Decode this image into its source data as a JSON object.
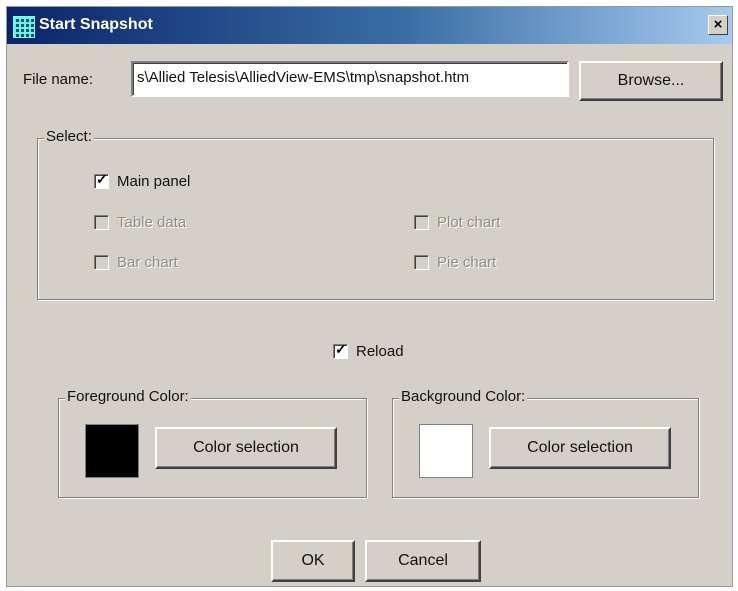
{
  "window": {
    "title": "Start Snapshot",
    "close_glyph": "×",
    "icon": "grid-app-icon"
  },
  "file": {
    "label": "File name:",
    "value": "s\\Allied Telesis\\AlliedView-EMS\\tmp\\snapshot.htm",
    "browse_label": "Browse..."
  },
  "select": {
    "legend": "Select:",
    "items": [
      {
        "label": "Main panel",
        "checked": true,
        "enabled": true
      },
      {
        "label": "Table data",
        "checked": false,
        "enabled": false
      },
      {
        "label": "Plot chart",
        "checked": false,
        "enabled": false
      },
      {
        "label": "Bar chart",
        "checked": false,
        "enabled": false
      },
      {
        "label": "Pie chart",
        "checked": false,
        "enabled": false
      }
    ]
  },
  "reload": {
    "label": "Reload",
    "checked": true
  },
  "foreground": {
    "legend": "Foreground Color:",
    "color": "#000000",
    "button_label": "Color selection"
  },
  "background": {
    "legend": "Background Color:",
    "color": "#ffffff",
    "button_label": "Color selection"
  },
  "buttons": {
    "ok": "OK",
    "cancel": "Cancel"
  },
  "check_glyph": "✓"
}
